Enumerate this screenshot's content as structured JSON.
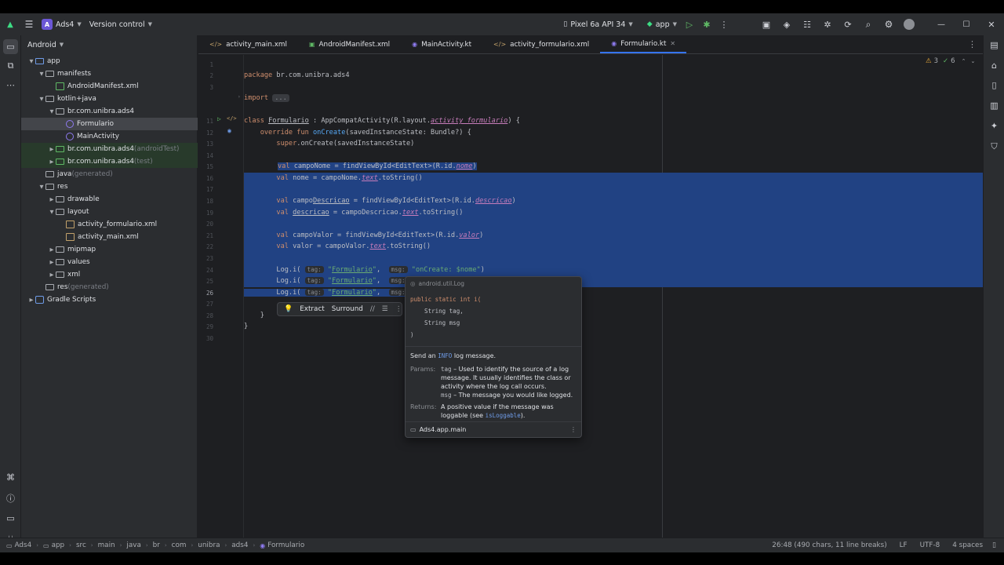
{
  "titlebar": {
    "project_badge": "A",
    "project_name": "Ads4",
    "vcs_label": "Version control",
    "device": "Pixel 6a API 34",
    "run_config": "app"
  },
  "left_strip_icons": [
    "folder-icon",
    "structure-icon",
    "more-icon",
    "logcat-icon",
    "problems-icon",
    "terminal-icon",
    "git-icon"
  ],
  "project_panel": {
    "view_label": "Android",
    "items": [
      {
        "label": "app",
        "suffix": "",
        "indent": 0,
        "arrow": "v",
        "icon": "folder blue"
      },
      {
        "label": "manifests",
        "suffix": "",
        "indent": 1,
        "arrow": "v",
        "icon": "folder"
      },
      {
        "label": "AndroidManifest.xml",
        "suffix": "",
        "indent": 2,
        "arrow": "",
        "icon": "file-manifest"
      },
      {
        "label": "kotlin+java",
        "suffix": "",
        "indent": 1,
        "arrow": "v",
        "icon": "folder"
      },
      {
        "label": "br.com.unibra.ads4",
        "suffix": "",
        "indent": 2,
        "arrow": "v",
        "icon": "folder"
      },
      {
        "label": "Formulario",
        "suffix": "",
        "indent": 3,
        "arrow": "",
        "icon": "file-kt",
        "selected": true
      },
      {
        "label": "MainActivity",
        "suffix": "",
        "indent": 3,
        "arrow": "",
        "icon": "file-kt"
      },
      {
        "label": "br.com.unibra.ads4",
        "suffix": " (androidTest)",
        "indent": 2,
        "arrow": ">",
        "icon": "folder green",
        "green": true
      },
      {
        "label": "br.com.unibra.ads4",
        "suffix": " (test)",
        "indent": 2,
        "arrow": ">",
        "icon": "folder green",
        "green": true
      },
      {
        "label": "java",
        "suffix": " (generated)",
        "indent": 1,
        "arrow": "",
        "icon": "folder"
      },
      {
        "label": "res",
        "suffix": "",
        "indent": 1,
        "arrow": "v",
        "icon": "folder"
      },
      {
        "label": "drawable",
        "suffix": "",
        "indent": 2,
        "arrow": ">",
        "icon": "folder"
      },
      {
        "label": "layout",
        "suffix": "",
        "indent": 2,
        "arrow": "v",
        "icon": "folder"
      },
      {
        "label": "activity_formulario.xml",
        "suffix": "",
        "indent": 3,
        "arrow": "",
        "icon": "file-xml"
      },
      {
        "label": "activity_main.xml",
        "suffix": "",
        "indent": 3,
        "arrow": "",
        "icon": "file-xml"
      },
      {
        "label": "mipmap",
        "suffix": "",
        "indent": 2,
        "arrow": ">",
        "icon": "folder"
      },
      {
        "label": "values",
        "suffix": "",
        "indent": 2,
        "arrow": ">",
        "icon": "folder"
      },
      {
        "label": "xml",
        "suffix": "",
        "indent": 2,
        "arrow": ">",
        "icon": "folder"
      },
      {
        "label": "res",
        "suffix": " (generated)",
        "indent": 1,
        "arrow": "",
        "icon": "folder"
      },
      {
        "label": "Gradle Scripts",
        "suffix": "",
        "indent": 0,
        "arrow": ">",
        "icon": "gradle"
      }
    ]
  },
  "tabs": [
    {
      "label": "activity_main.xml",
      "icon": "</>"
    },
    {
      "label": "AndroidManifest.xml",
      "icon": "M"
    },
    {
      "label": "MainActivity.kt",
      "icon": "K"
    },
    {
      "label": "activity_formulario.xml",
      "icon": "</>"
    },
    {
      "label": "Formulario.kt",
      "icon": "K",
      "active": true
    }
  ],
  "inspections": {
    "warnings": "3",
    "checks": "6"
  },
  "editor": {
    "line_numbers": [
      "1",
      "2",
      "3",
      "",
      "11",
      "12",
      "13",
      "14",
      "15",
      "16",
      "17",
      "18",
      "19",
      "20",
      "21",
      "22",
      "23",
      "24",
      "25",
      "26",
      "27",
      "28",
      "29",
      "30"
    ],
    "current_line": "26"
  },
  "intention_bar": {
    "extract": "Extract",
    "surround": "Surround"
  },
  "doc_popup": {
    "package": "android.util.Log",
    "signature_1": "public static int i(",
    "signature_2": "    String tag,",
    "signature_3": "    String msg",
    "signature_4": ")",
    "summary_pre": "Send an ",
    "summary_code": "INFO",
    "summary_post": " log message.",
    "params_label": "Params:",
    "param_tag_name": "tag",
    "param_tag_desc": " – Used to identify the source of a log message. It usually identifies the class or activity where the log call occurs.",
    "param_msg_name": "msg",
    "param_msg_desc": " – The message you would like logged.",
    "returns_label": "Returns:",
    "returns_desc": "A positive value if the message was loggable (see ",
    "returns_link": "isLoggable",
    "returns_end": ").",
    "module": "Ads4.app.main"
  },
  "statusbar": {
    "breadcrumbs": [
      "Ads4",
      "app",
      "src",
      "main",
      "java",
      "br",
      "com",
      "unibra",
      "ads4",
      "Formulario"
    ],
    "position": "26:48 (490 chars, 11 line breaks)",
    "line_sep": "LF",
    "encoding": "UTF-8",
    "indent": "4 spaces"
  },
  "colors": {
    "accent": "#3574f0",
    "selection": "#214283",
    "bg": "#1e1f22",
    "panel": "#2b2d30"
  }
}
